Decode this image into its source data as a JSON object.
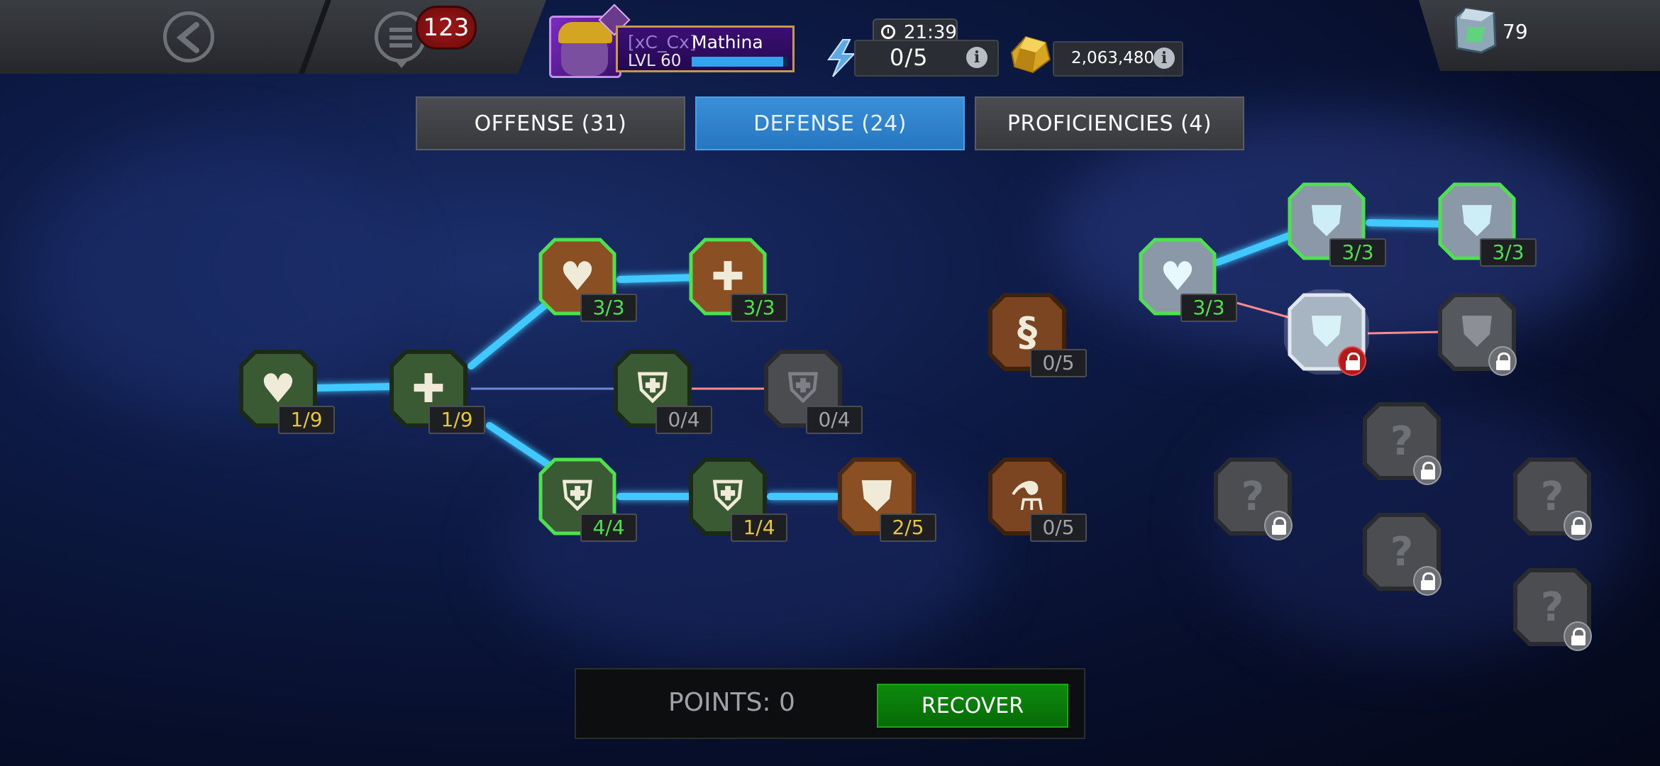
{
  "header": {
    "notification_count": "123",
    "player": {
      "alliance": "[xC_Cx]",
      "name": "Mathina",
      "level": "LVL 60",
      "xp_fraction": 0.95
    },
    "energy": {
      "value": "0/5",
      "timer": "21:39"
    },
    "gold": {
      "value": "2,063,480"
    },
    "crystals": {
      "value": "79"
    }
  },
  "tabs": [
    {
      "label": "OFFENSE (31)",
      "active": false
    },
    {
      "label": "DEFENSE (24)",
      "active": true
    },
    {
      "label": "PROFICIENCIES (4)",
      "active": false
    }
  ],
  "tree": {
    "nodes": {
      "health": {
        "icon": "heart-icon",
        "rank": "1/9"
      },
      "recovery": {
        "icon": "cross-icon",
        "rank": "1/9"
      },
      "block_proficiency": {
        "icon": "heart-up-icon",
        "rank": "3/3"
      },
      "salve": {
        "icon": "plus-cluster-icon",
        "rank": "3/3"
      },
      "block_resist": {
        "icon": "shield-bolt-icon",
        "rank": "0/4"
      },
      "block_locked": {
        "icon": "cracked-shield-icon",
        "rank": "0/4"
      },
      "parry": {
        "icon": "burst-shield-icon",
        "rank": "4/4"
      },
      "stupefy": {
        "icon": "burst-shield-icon",
        "rank": "1/4"
      },
      "petrify": {
        "icon": "shield-icon",
        "rank": "2/5"
      },
      "mystic_dispersion": {
        "icon": "scroll-icon",
        "rank": "0/5"
      },
      "glancing": {
        "icon": "flask-icon",
        "rank": "0/5"
      },
      "vitality": {
        "icon": "hearts-icon",
        "rank": "3/3"
      },
      "resist_a": {
        "icon": "drop-shield-icon",
        "rank": "3/3"
      },
      "resist_b": {
        "icon": "drop-shield-icon",
        "rank": "3/3"
      }
    }
  },
  "footer": {
    "points_label": "POINTS: 0",
    "recover_label": "RECOVER"
  }
}
